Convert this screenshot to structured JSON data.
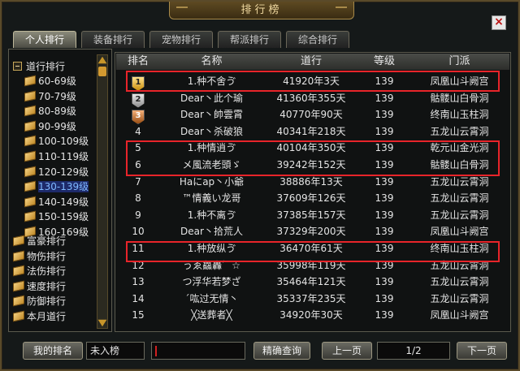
{
  "window": {
    "title": "排行榜",
    "close_label": "×"
  },
  "tabs": [
    "个人排行",
    "装备排行",
    "宠物排行",
    "帮派排行",
    "综合排行"
  ],
  "tree": {
    "root": "道行排行",
    "levels": [
      "60-69级",
      "70-79级",
      "80-89级",
      "90-99级",
      "100-109级",
      "110-119级",
      "120-129级",
      "130-139级",
      "140-149级",
      "150-159级",
      "160-169级"
    ],
    "selected": "130-139级",
    "others": [
      "富豪排行",
      "物伤排行",
      "法伤排行",
      "速度排行",
      "防御排行",
      "本月道行"
    ]
  },
  "table": {
    "headers": [
      "排名",
      "名称",
      "道行",
      "等级",
      "门派"
    ],
    "rows": [
      {
        "rank": "1",
        "medal": "gold",
        "name": "1.种不舍ゔ",
        "dao": "41920年3天",
        "level": "139",
        "school": "凤凰山斗阙宫"
      },
      {
        "rank": "2",
        "medal": "silver",
        "name": "Dear丶此个瑜",
        "dao": "41360年355天",
        "level": "139",
        "school": "骷髅山白骨洞"
      },
      {
        "rank": "3",
        "medal": "bronze",
        "name": "Dear丶帥雲霄",
        "dao": "40770年90天",
        "level": "139",
        "school": "终南山玉柱洞"
      },
      {
        "rank": "4",
        "medal": "",
        "name": "Dear丶杀破狼",
        "dao": "40341年218天",
        "level": "139",
        "school": "五龙山云霄洞"
      },
      {
        "rank": "5",
        "medal": "",
        "name": "1.种情逍ゔ",
        "dao": "40104年350天",
        "level": "139",
        "school": "乾元山金光洞"
      },
      {
        "rank": "6",
        "medal": "",
        "name": "メ風流老頭ゞ",
        "dao": "39242年152天",
        "level": "139",
        "school": "骷髅山白骨洞"
      },
      {
        "rank": "7",
        "medal": "",
        "name": "Haにap丶小爺",
        "dao": "38886年13天",
        "level": "139",
        "school": "五龙山云霄洞"
      },
      {
        "rank": "8",
        "medal": "",
        "name": "™情義い龙哥",
        "dao": "37609年126天",
        "level": "139",
        "school": "五龙山云霄洞"
      },
      {
        "rank": "9",
        "medal": "",
        "name": "1.种不离ゔ",
        "dao": "37385年157天",
        "level": "139",
        "school": "五龙山云霄洞"
      },
      {
        "rank": "10",
        "medal": "",
        "name": "Dear丶拾荒人",
        "dao": "37329年200天",
        "level": "139",
        "school": "凤凰山斗阙宫"
      },
      {
        "rank": "11",
        "medal": "",
        "name": "1.种放纵ゔ",
        "dao": "36470年61天",
        "level": "139",
        "school": "终南山玉柱洞"
      },
      {
        "rank": "12",
        "medal": "",
        "name": "うゑ鱻轟゛☆",
        "dao": "35998年119天",
        "level": "139",
        "school": "五龙山云霄洞"
      },
      {
        "rank": "13",
        "medal": "",
        "name": "つ浮华若梦ざ",
        "dao": "35464年121天",
        "level": "139",
        "school": "五龙山云霄洞"
      },
      {
        "rank": "14",
        "medal": "",
        "name": "ˊ吰过无情丶",
        "dao": "35337年235天",
        "level": "139",
        "school": "五龙山云霄洞"
      },
      {
        "rank": "15",
        "medal": "",
        "name": "╳送葬者╳",
        "dao": "34920年30天",
        "level": "139",
        "school": "凤凰山斗阙宫"
      }
    ]
  },
  "footer": {
    "my_rank_label": "我的排名",
    "my_rank_value": "未入榜",
    "search_value": "",
    "search_button": "精确查询",
    "prev_button": "上一页",
    "page": "1/2",
    "next_button": "下一页"
  },
  "colors": {
    "highlight": "#e8242a",
    "selected": "#7fb8ff",
    "gold": "#c98f10"
  }
}
